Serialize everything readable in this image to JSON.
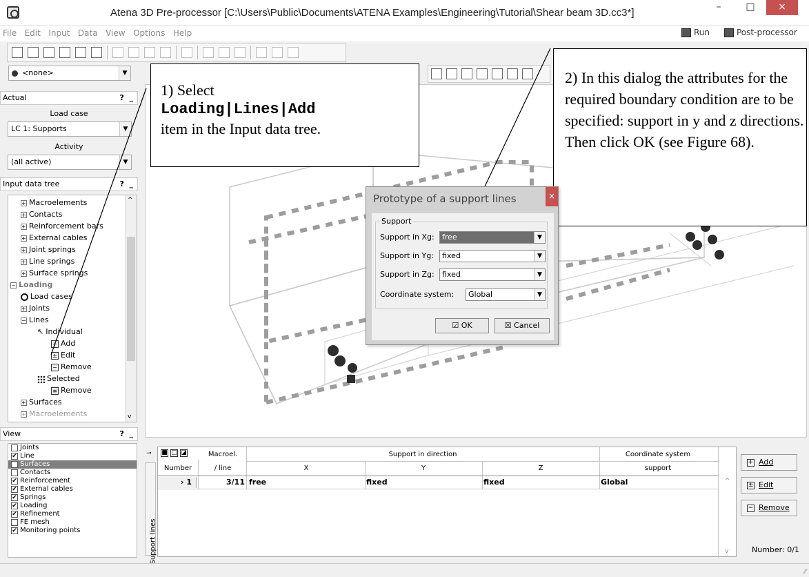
{
  "window": {
    "title": "Atena 3D Pre-processor [C:\\Users\\Public\\Documents\\ATENA Examples\\Engineering\\Tutorial\\Shear beam 3D.cc3*]",
    "minimize": "–",
    "maximize": "□",
    "close": "×"
  },
  "menu": {
    "items": [
      "File",
      "Edit",
      "Input",
      "Data",
      "View",
      "Options",
      "Help"
    ],
    "run": "Run",
    "post_processor": "Post-processor"
  },
  "toolbar2": {
    "selector_value": "<none>"
  },
  "actual_panel": {
    "title": "Actual",
    "help": "?",
    "minimize": "_",
    "load_case_label": "Load case",
    "load_case_value": "LC 1: Supports",
    "activity_label": "Activity",
    "activity_value": "(all active)"
  },
  "input_tree": {
    "title": "Input data tree",
    "help": "?",
    "minimize": "_",
    "items": [
      "Macroelements",
      "Contacts",
      "Reinforcement bars",
      "External cables",
      "Joint springs",
      "Line springs",
      "Surface springs",
      "Loading",
      "Load cases",
      "Joints",
      "Lines",
      "Individual",
      "Add",
      "Edit",
      "Remove",
      "Selected",
      "Remove",
      "Surfaces",
      "Macroelements"
    ]
  },
  "view_panel": {
    "title": "View",
    "help": "?",
    "minimize": "_",
    "items": [
      {
        "label": "Joints",
        "checked": false
      },
      {
        "label": "Line",
        "checked": true
      },
      {
        "label": "Surfaces",
        "checked": false
      },
      {
        "label": "Contacts",
        "checked": false
      },
      {
        "label": "Reinforcement",
        "checked": true
      },
      {
        "label": "External cables",
        "checked": true
      },
      {
        "label": "Springs",
        "checked": true
      },
      {
        "label": "Loading",
        "checked": true
      },
      {
        "label": "Refinement",
        "checked": true
      },
      {
        "label": "FE mesh",
        "checked": false
      },
      {
        "label": "Monitoring points",
        "checked": true
      }
    ]
  },
  "callout1": {
    "line1": "1) Select",
    "line2": "Loading|Lines|Add",
    "line3": "item in the Input data tree."
  },
  "callout2": {
    "text": "2) In this dialog the attributes for the required boundary condition are to be specified: support in y and z directions. Then click OK (see Figure 68)."
  },
  "dialog": {
    "title": "Prototype of a support lines",
    "close": "×",
    "group": "Support",
    "support_x_label": "Support in Xg:",
    "support_x_value": "free",
    "support_y_label": "Support in Yg:",
    "support_y_value": "fixed",
    "support_z_label": "Support in Zg:",
    "support_z_value": "fixed",
    "coord_label": "Coordinate system:",
    "coord_value": "Global",
    "ok": "OK",
    "cancel": "Cancel"
  },
  "table": {
    "side_tab": "Support lines",
    "headers": {
      "number": "Number",
      "macroel_1": "Macroel.",
      "macroel_2": "/ line",
      "support_dir": "Support in direction",
      "x": "X",
      "y": "Y",
      "z": "Z",
      "coord_1": "Coordinate system",
      "coord_2": "support"
    },
    "rows": [
      {
        "number": "1",
        "macroel": "3/11",
        "x": "free",
        "y": "fixed",
        "z": "fixed",
        "coord": "Global"
      }
    ]
  },
  "side_buttons": {
    "add": "Add",
    "edit": "Edit",
    "remove": "Remove",
    "count": "Number: 0/1"
  }
}
